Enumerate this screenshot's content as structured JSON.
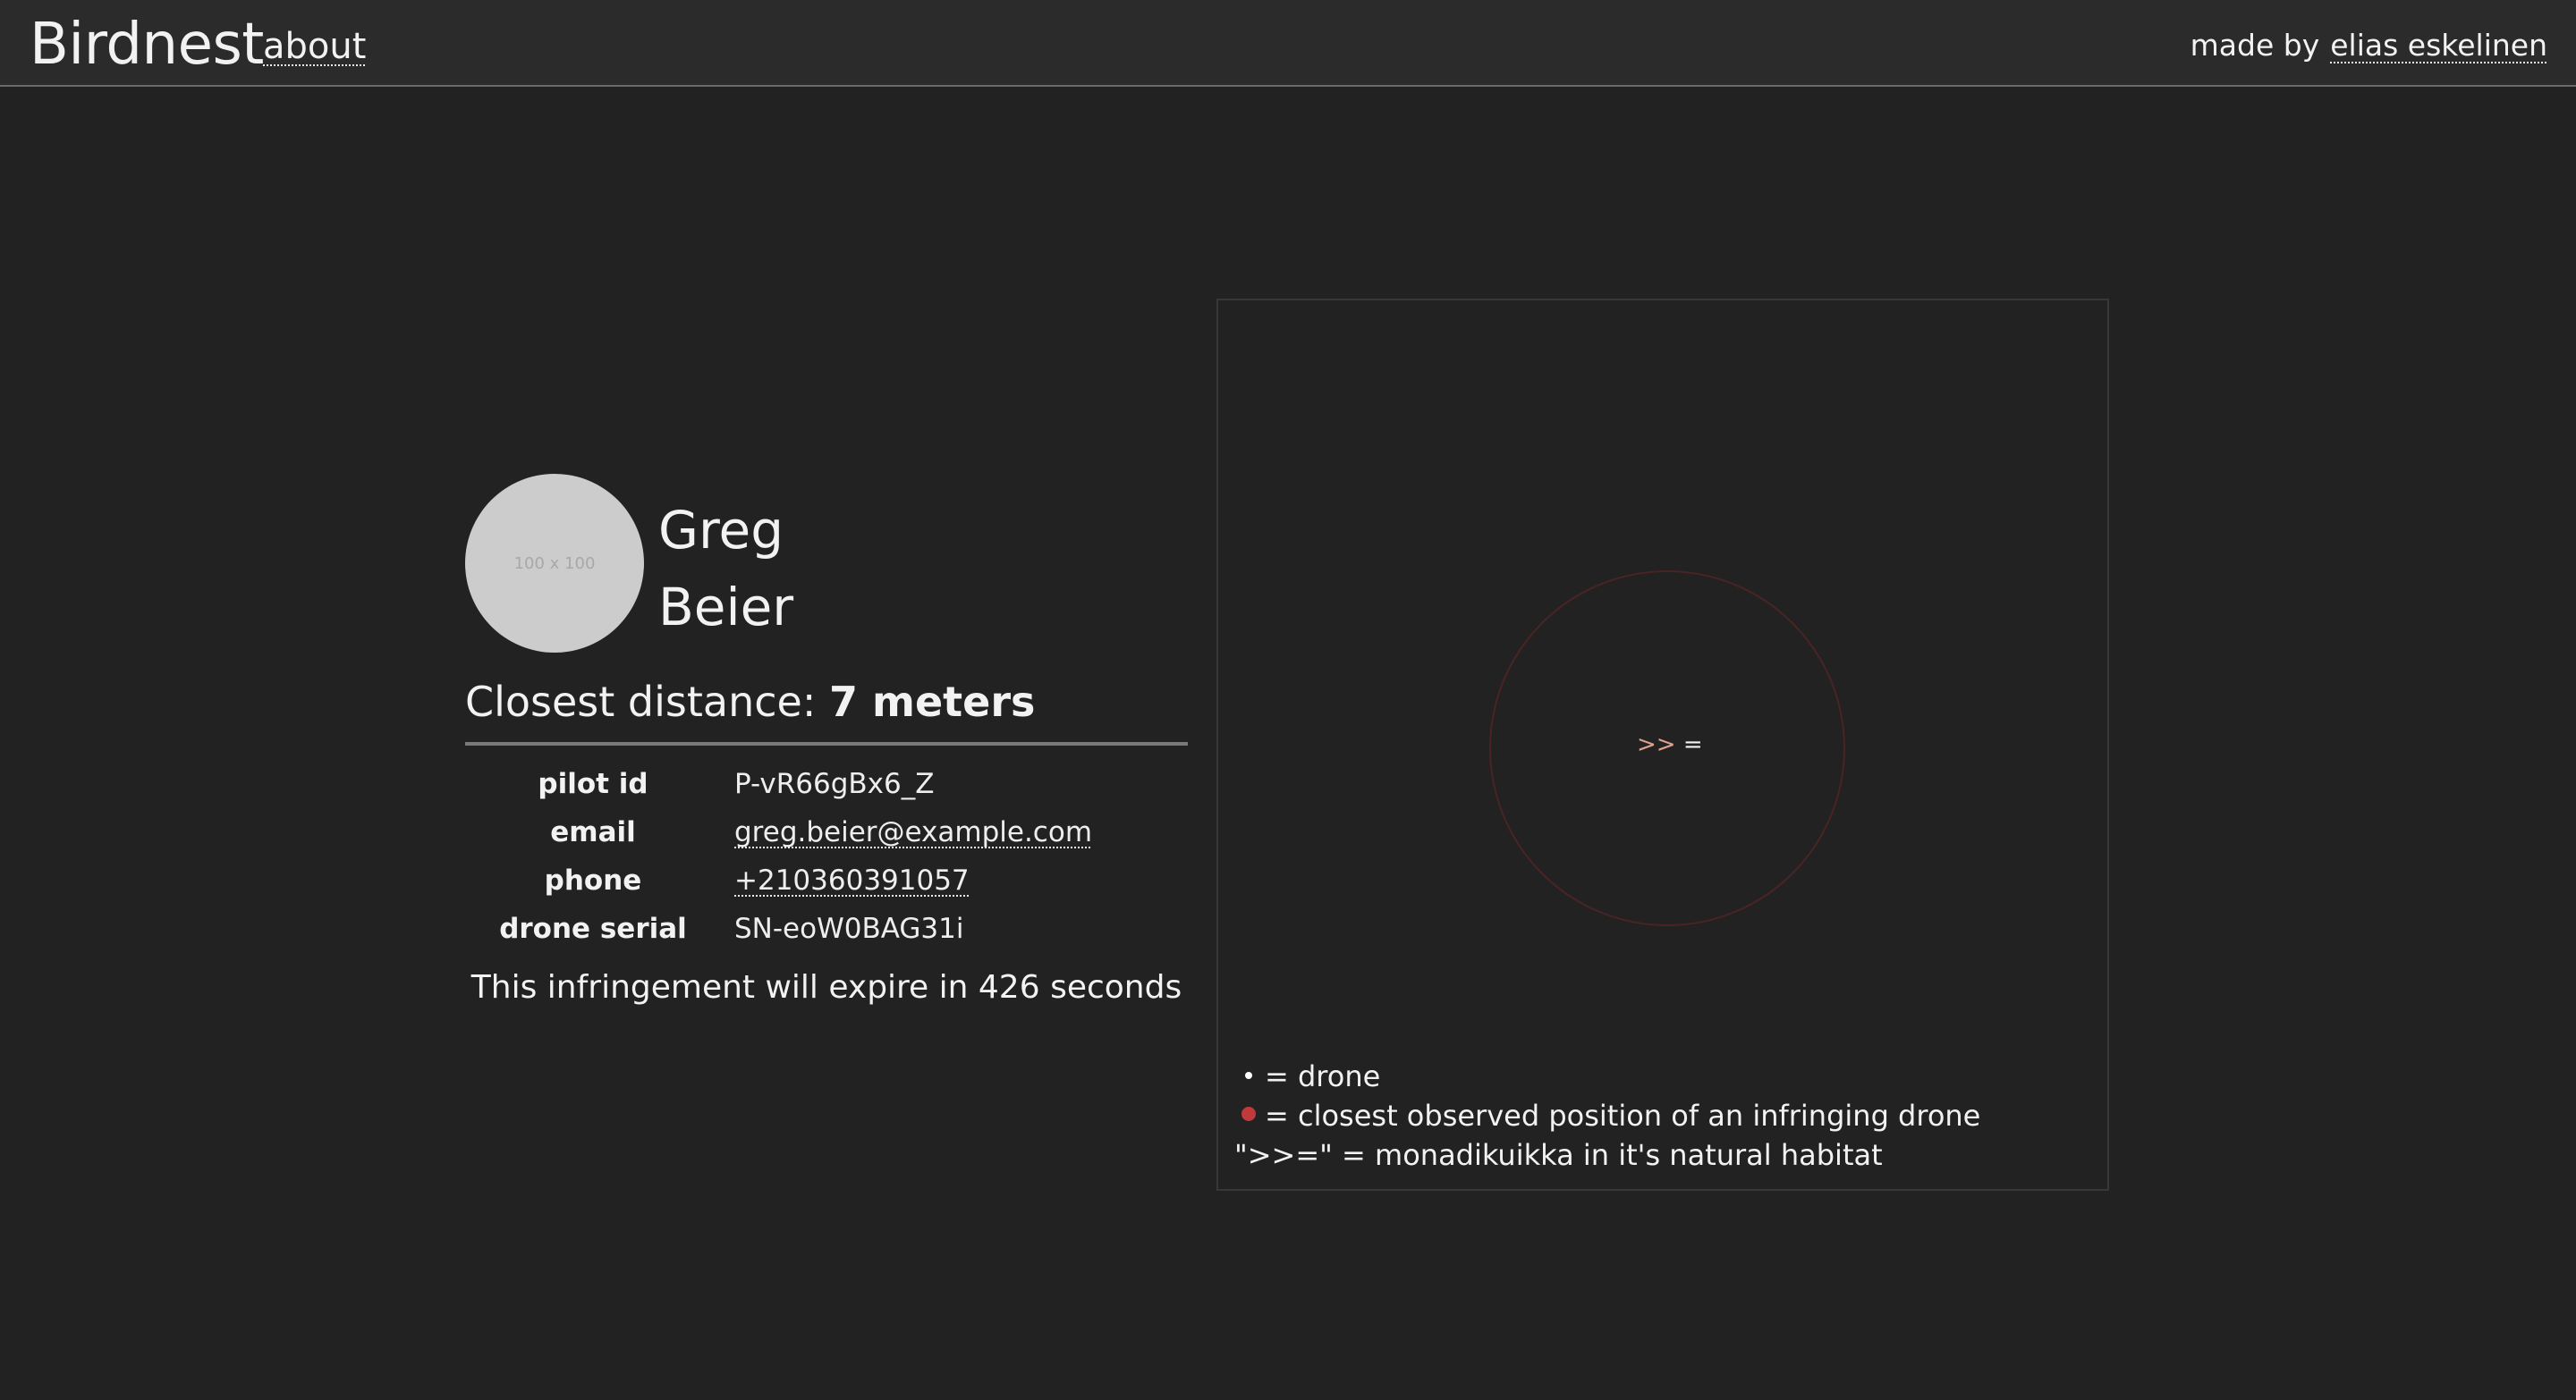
{
  "header": {
    "brand": "Birdnest",
    "about_label": "about",
    "credit_prefix": "made by",
    "credit_name": "elias eskelinen"
  },
  "pilot": {
    "avatar_placeholder": "100 x 100",
    "first_name": "Greg",
    "last_name": "Beier",
    "distance_label": "Closest distance:",
    "distance_value": "7 meters",
    "fields": [
      {
        "key": "pilot id",
        "value": "P-vR66gBx6_Z"
      },
      {
        "key": "email",
        "value": "greg.beier@example.com"
      },
      {
        "key": "phone",
        "value": "+210360391057"
      },
      {
        "key": "drone serial",
        "value": "SN-eoW0BAG31i"
      }
    ],
    "expire_text": "This infringement will expire in 426 seconds"
  },
  "map": {
    "bird_beak": ">>",
    "bird_body": "=",
    "legend": [
      {
        "text": "= drone"
      },
      {
        "text": "= closest observed position of an infringing drone"
      },
      {
        "text": "\">>=\" = monadikuikka in it's natural habitat"
      }
    ],
    "colors": {
      "zone_border": "#4a2424",
      "infringing_dot": "#c0393b"
    }
  }
}
